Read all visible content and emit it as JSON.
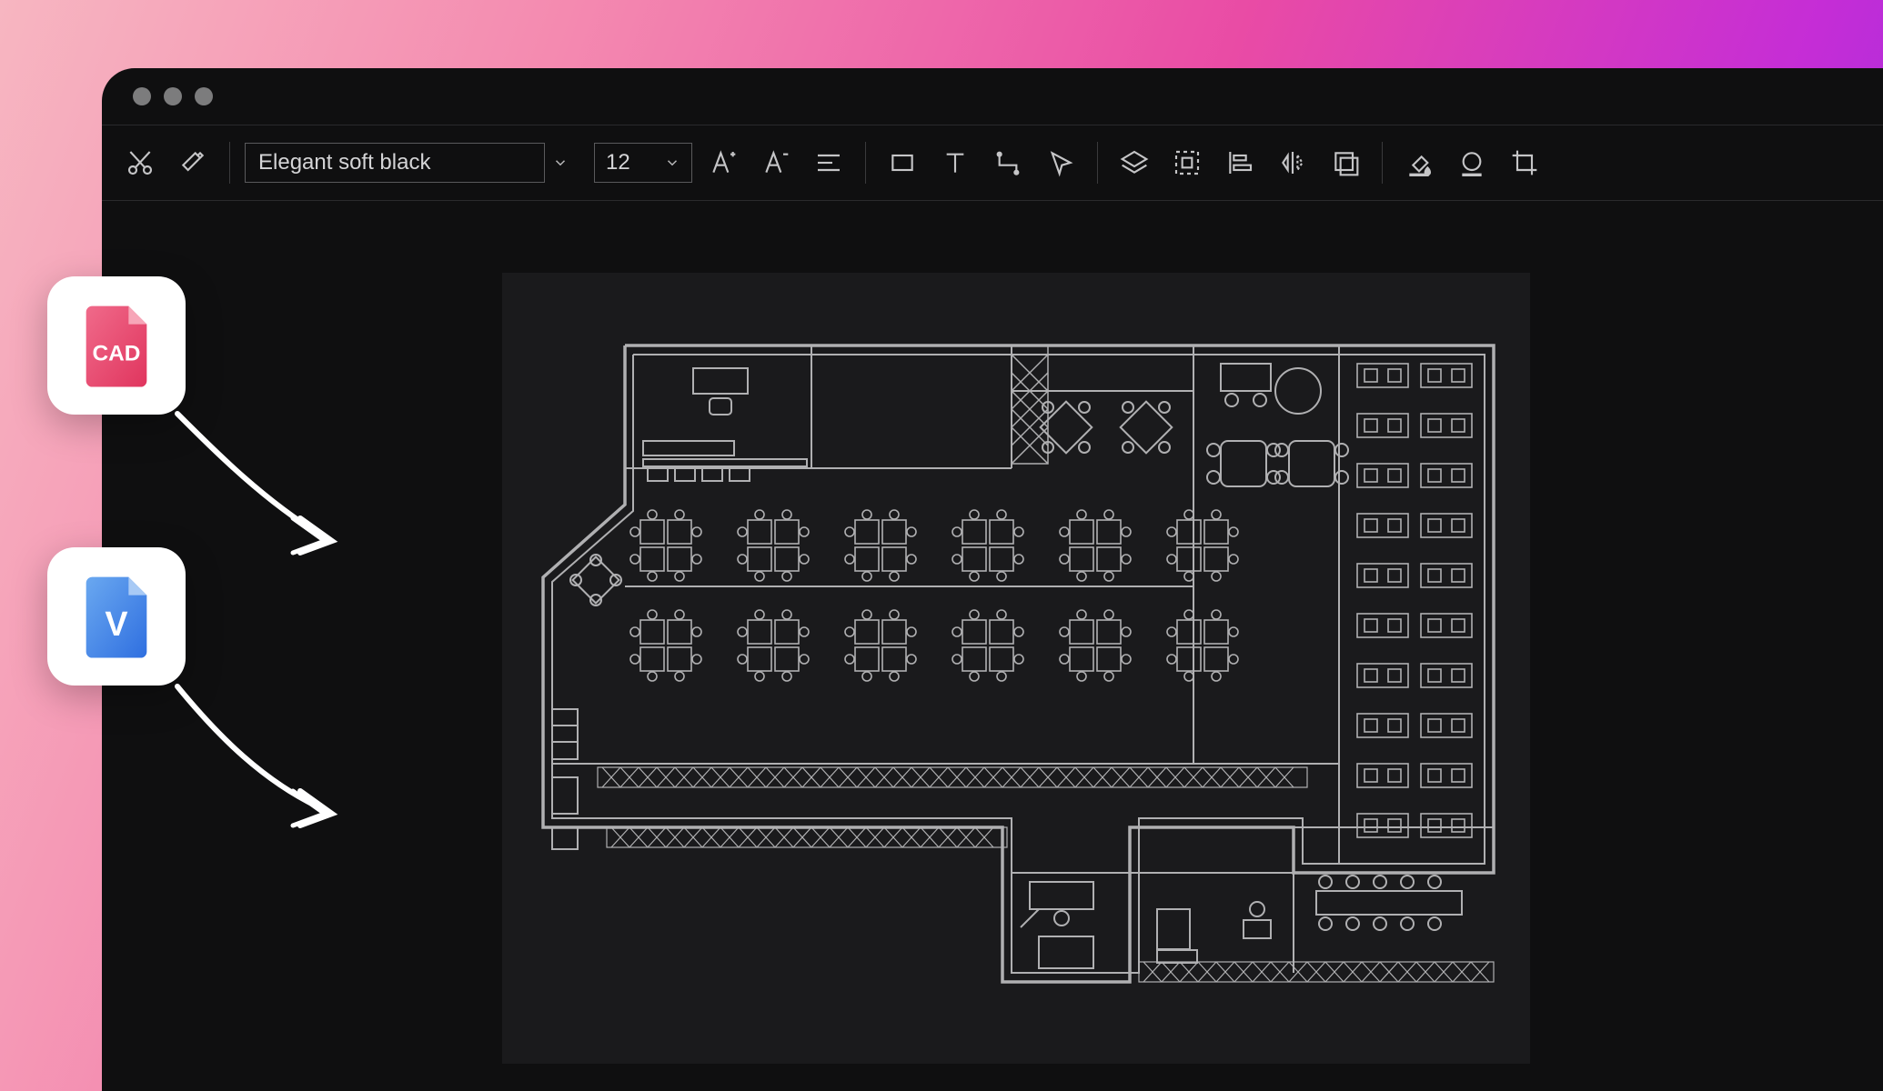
{
  "toolbar": {
    "font_family": "Elegant soft black",
    "font_size": "12"
  },
  "file_badges": {
    "cad_label": "CAD",
    "visio_label": "V"
  },
  "icons": {
    "cut": "cut-icon",
    "format_painter": "format-painter-icon",
    "font_increase": "font-increase-icon",
    "font_decrease": "font-decrease-icon",
    "align": "align-icon",
    "rectangle": "rectangle-icon",
    "text": "text-icon",
    "connector": "connector-icon",
    "pointer": "pointer-icon",
    "layers": "layers-icon",
    "group": "group-icon",
    "align_left": "align-left-icon",
    "flip": "flip-icon",
    "bounds": "bounds-icon",
    "fill": "fill-icon",
    "stroke": "stroke-icon",
    "crop": "crop-icon"
  },
  "canvas": {
    "content": "office-floor-plan"
  }
}
